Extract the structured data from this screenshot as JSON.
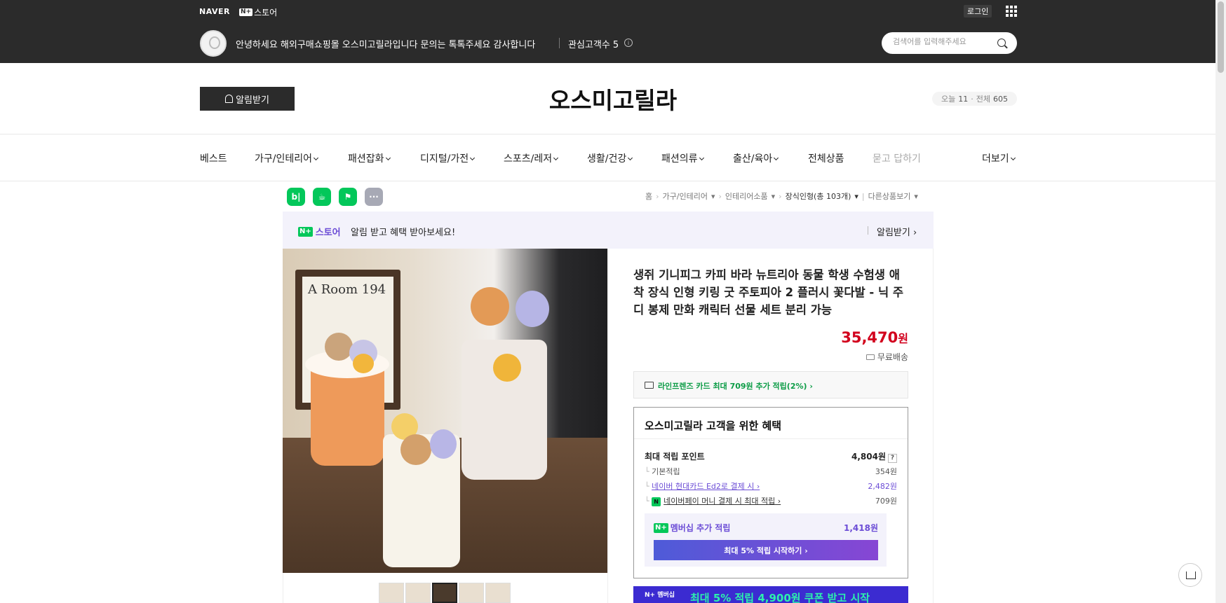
{
  "topbar": {
    "naver_logo": "NAVER",
    "store_logo_badge": "N+",
    "store_logo_label": "스토어",
    "login_label": "로그인",
    "greeting": "안녕하세요 해외구매쇼핑몰 오스미고릴라입니다 문의는 톡톡주세요 감사합니다",
    "favorite_label": "관심고객수 5",
    "search_placeholder": "검색어를 입력해주세요"
  },
  "store": {
    "alarm_label": "알림받기",
    "title": "오스미고릴라",
    "visitors_today_label": "오늘",
    "visitors_today": "11",
    "visitors_total_label": "전체",
    "visitors_total": "605"
  },
  "menu": [
    {
      "label": "베스트"
    },
    {
      "label": "가구/인테리어"
    },
    {
      "label": "패션잡화"
    },
    {
      "label": "디지털/가전"
    },
    {
      "label": "스포츠/레저"
    },
    {
      "label": "생활/건강"
    },
    {
      "label": "패션의류"
    },
    {
      "label": "출산/육아"
    },
    {
      "label": "전체상품"
    },
    {
      "label": "묻고 답하기"
    },
    {
      "label": "더보기"
    }
  ],
  "share_icons": [
    {
      "name": "blog-icon",
      "glyph": "b|",
      "color": "#03c75a"
    },
    {
      "name": "cafe-icon",
      "glyph": "☕",
      "color": "#03c75a"
    },
    {
      "name": "bookmark-icon",
      "glyph": "⚑",
      "color": "#03c75a"
    },
    {
      "name": "more-icon",
      "glyph": "···",
      "color": "#a7a9b5"
    }
  ],
  "breadcrumb": {
    "home": "홈",
    "cat1": "가구/인테리어",
    "cat2": "인테리어소품",
    "cat3": "장식인형(총 103개)",
    "other": "다른상품보기"
  },
  "notice": {
    "badge": "N+",
    "label": "스토어",
    "text": "알림 받고 혜택 받아보세요!",
    "alarm": "알림받기"
  },
  "photo": {
    "frame_text": "A Room 194"
  },
  "product": {
    "title": "생쥐 기니피그 카피 바라 뉴트리아 동물 학생 수험생 애착 장식 인형 키링 굿 주토피아 2 플러시 꽃다발 - 닉 주디 봉제 만화 캐릭터 선물 세트 분리 가능",
    "price": "35,470",
    "price_unit": "원",
    "shipping": "무료배송",
    "card_benefit": "라인프렌즈 카드 최대 709원 추가 적립(2%) ›"
  },
  "benefit": {
    "title": "오스미고릴라 고객을 위한 혜택",
    "max_label": "최대 적립 포인트",
    "max_value": "4,804원",
    "rows": [
      {
        "label": "기본적립",
        "value": "354원"
      },
      {
        "label": "네이버 현대카드 Ed2로 결제 시 ›",
        "value": "2,482원"
      },
      {
        "label": "네이버페이 머니 결제 시 최대 적립 ›",
        "value": "709원"
      }
    ],
    "member_label": "멤버십 추가 적립",
    "member_value": "1,418원",
    "member_button": "최대 5% 적립 시작하기 ›"
  },
  "promo": {
    "badge": "N+ 멤버십",
    "text": "최대 5% 적립 4,900원 쿠폰 받고 시작"
  },
  "colors": {
    "topbar_bg": "#2b2b2b",
    "price": "#d2001d",
    "naver_green": "#03c75a",
    "purple": "#6b4cd6"
  }
}
